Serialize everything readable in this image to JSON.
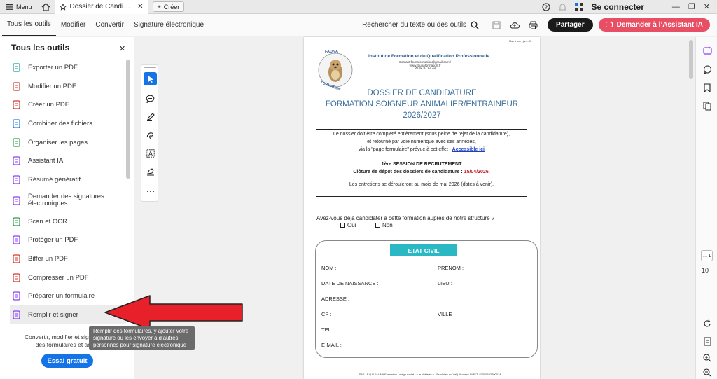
{
  "titlebar": {
    "menu_label": "Menu",
    "tab_title": "Dossier de Candidatu...",
    "new_tab_label": "Créer",
    "login_label": "Se connecter"
  },
  "toolbar": {
    "tabs": [
      "Tous les outils",
      "Modifier",
      "Convertir",
      "Signature électronique"
    ],
    "search_label": "Rechercher du texte ou des outils",
    "share_label": "Partager",
    "ai_label": "Demander à l’Assistant IA"
  },
  "left_panel": {
    "title": "Tous les outils",
    "items": [
      {
        "label": "Exporter un PDF",
        "icon": "export-pdf-icon",
        "color": "#1a9e9e"
      },
      {
        "label": "Modifier un PDF",
        "icon": "edit-pdf-icon",
        "color": "#d7372f"
      },
      {
        "label": "Créer un PDF",
        "icon": "create-pdf-icon",
        "color": "#d7372f"
      },
      {
        "label": "Combiner des fichiers",
        "icon": "combine-files-icon",
        "color": "#2a7de1"
      },
      {
        "label": "Organiser les pages",
        "icon": "organize-pages-icon",
        "color": "#2e9d4a"
      },
      {
        "label": "Assistant IA",
        "icon": "ai-assistant-icon",
        "color": "#8a3ffc"
      },
      {
        "label": "Résumé génératif",
        "icon": "generative-summary-icon",
        "color": "#8a3ffc"
      },
      {
        "label": "Demander des signatures électroniques",
        "icon": "request-signatures-icon",
        "color": "#8a3ffc"
      },
      {
        "label": "Scan et OCR",
        "icon": "scan-ocr-icon",
        "color": "#2e9d4a"
      },
      {
        "label": "Protéger un PDF",
        "icon": "protect-pdf-icon",
        "color": "#8a3ffc"
      },
      {
        "label": "Biffer un PDF",
        "icon": "redact-pdf-icon",
        "color": "#d7372f"
      },
      {
        "label": "Compresser un PDF",
        "icon": "compress-pdf-icon",
        "color": "#d7372f"
      },
      {
        "label": "Préparer un formulaire",
        "icon": "prepare-form-icon",
        "color": "#8a3ffc"
      },
      {
        "label": "Remplir et signer",
        "icon": "fill-sign-icon",
        "color": "#8a3ffc"
      }
    ],
    "footer_line1": "Convertir, modifier et signer élec",
    "footer_line2": "des formulaires et accor",
    "trial_label": "Essai gratuit"
  },
  "tooltip": {
    "line1": "Remplir des formulaires, y ajouter votre",
    "line2": "signature ou les envoyer à d’autres",
    "line3": "personnes pour signature électronique"
  },
  "document": {
    "updated": "Mise à jour : janv.-26",
    "logo_text_top": "FAUNA",
    "logo_text_bottom": "FORMATION",
    "institute": "Institut de Formation et de Qualification Professionnelle",
    "contact": "Contact.faunaformation@gmail.com / www.faunaformation.fr",
    "phone": "06 82 87 03 33",
    "title1": "DOSSIER DE CANDIDATURE",
    "title2": "FORMATION SOIGNEUR ANIMALIER/ENTRAINEUR",
    "title3": "2026/2027",
    "box_line1": "Le dossier doit être complété entièrement (sous peine de rejet de la candidature),",
    "box_line2": "et retourné par voie numérique avec ses annexes,",
    "box_line3": "via la \"page formulaire\" prévue à cet effet  :",
    "box_link": "Accessible ici",
    "session": "1ère SESSION DE RECRUTEMENT",
    "deadline_label": "Clôture de dépôt des dossiers de candidature :",
    "deadline_date": "15/04/2026.",
    "interviews": "Les entretiens se dérouleront au mois de mai 2026 (dates à venir).",
    "question": "Avez-vous déjà candidater à cette formation auprès de notre structure ?",
    "opt_yes": "Oui",
    "opt_no": "Non",
    "civil_header": "ETAT CIVIL",
    "fields": {
      "nom": "NOM :",
      "prenom": "PRENOM :",
      "dob": "DATE DE NAISSANCE :",
      "lieu": "LIEU :",
      "adresse": "ADRESSE :",
      "cp": "CP :",
      "ville": "VILLE :",
      "tel": "TEL :",
      "email": "E-MAIL :"
    },
    "footer": "SAS I.F.Q.P FAUNA Formation | siège social : « le château » - Pradelles en Val | Numéro SIRET: 82059642700014"
  },
  "right_sidebar": {
    "page_current": "1",
    "page_total": "10"
  }
}
